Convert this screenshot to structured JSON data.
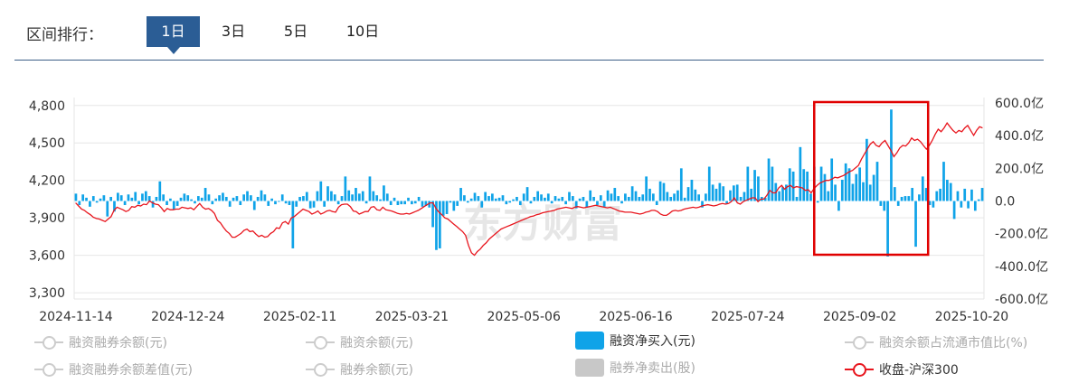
{
  "tabs": {
    "label": "区间排行：",
    "items": [
      "1日",
      "3日",
      "5日",
      "10日"
    ],
    "active": "1日"
  },
  "colors": {
    "bars": "#0fa3e8",
    "line": "#e8151d",
    "highlight": "#e00000",
    "watermark": "#e6e6e6"
  },
  "watermark": "东方财富",
  "legend": [
    {
      "label": "融资融券余额(元)",
      "symbol": "line",
      "active": false
    },
    {
      "label": "融资余额(元)",
      "symbol": "line",
      "active": false
    },
    {
      "label": "融资净买入(元)",
      "symbol": "bar",
      "color": "#0fa3e8",
      "active": true
    },
    {
      "label": "融资余额占流通市值比(%)",
      "symbol": "line",
      "active": false
    },
    {
      "label": "融资融券余额差值(元)",
      "symbol": "line",
      "active": false
    },
    {
      "label": "融券余额(元)",
      "symbol": "line",
      "active": false
    },
    {
      "label": "融券净卖出(股)",
      "symbol": "bar",
      "color": "#c8c8c8",
      "active": false
    },
    {
      "label": "收盘-沪深300",
      "symbol": "line-red",
      "active": true
    }
  ],
  "chart_data": {
    "type": "bar+line",
    "x_tick_labels": [
      "2024-11-14",
      "2024-12-24",
      "2025-02-11",
      "2025-03-21",
      "2025-05-06",
      "2025-06-16",
      "2025-07-24",
      "2025-09-02",
      "2025-10-20"
    ],
    "left_axis": {
      "ticks": [
        "4,800",
        "4,500",
        "4,200",
        "3,900",
        "3,600",
        "3,300"
      ],
      "ylim": [
        3250,
        4820
      ]
    },
    "right_axis": {
      "ticks": [
        "600.0亿",
        "400.0亿",
        "200.0亿",
        "0.0",
        "-200.0亿",
        "-400.0亿",
        "-600.0亿"
      ],
      "ylim": [
        -600,
        600
      ]
    },
    "grid": true,
    "highlight_box": {
      "from_index": 212,
      "to_index": 242
    },
    "series": [
      {
        "name": "融资净买入(元)",
        "axis": "right",
        "type": "bar",
        "values": [
          45,
          -25,
          40,
          20,
          -35,
          30,
          -10,
          15,
          35,
          -95,
          25,
          -65,
          50,
          35,
          -25,
          40,
          20,
          55,
          -20,
          45,
          60,
          30,
          -40,
          25,
          120,
          40,
          -25,
          15,
          -55,
          -30,
          20,
          45,
          35,
          10,
          -15,
          30,
          20,
          80,
          40,
          -20,
          15,
          35,
          50,
          25,
          -35,
          20,
          30,
          -25,
          40,
          60,
          35,
          -55,
          25,
          65,
          40,
          -30,
          15,
          -20,
          -5,
          40,
          -15,
          -25,
          -290,
          -35,
          25,
          30,
          55,
          -45,
          -40,
          60,
          120,
          -35,
          90,
          60,
          40,
          -20,
          30,
          150,
          65,
          40,
          80,
          45,
          60,
          -15,
          150,
          60,
          35,
          10,
          95,
          45,
          -25,
          20,
          -25,
          -20,
          -20,
          20,
          -20,
          -15,
          25,
          -35,
          -30,
          -40,
          -160,
          -300,
          -290,
          -90,
          -80,
          -10,
          -60,
          -30,
          80,
          35,
          -10,
          15,
          50,
          30,
          -40,
          55,
          30,
          45,
          15,
          20,
          35,
          -20,
          -10,
          10,
          25,
          -25,
          45,
          85,
          -15,
          25,
          60,
          40,
          20,
          45,
          -15,
          30,
          15,
          25,
          -20,
          55,
          30,
          -45,
          15,
          25,
          -40,
          65,
          25,
          -25,
          35,
          -35,
          65,
          45,
          80,
          30,
          -15,
          45,
          25,
          90,
          60,
          25,
          40,
          150,
          75,
          45,
          -25,
          120,
          110,
          55,
          25,
          45,
          65,
          200,
          20,
          85,
          130,
          70,
          40,
          -40,
          45,
          210,
          100,
          75,
          110,
          90,
          -15,
          65,
          95,
          100,
          25,
          55,
          210,
          75,
          190,
          150,
          25,
          20,
          260,
          210,
          110,
          60,
          85,
          100,
          200,
          180,
          25,
          330,
          195,
          180,
          45,
          210,
          -10,
          210,
          165,
          60,
          260,
          100,
          -60,
          130,
          230,
          200,
          105,
          165,
          205,
          115,
          380,
          100,
          160,
          240,
          -30,
          -60,
          -340,
          560,
          85,
          -30,
          25,
          30,
          30,
          80,
          -280,
          40,
          150,
          80,
          -25,
          -40,
          60,
          75,
          240,
          130,
          110,
          -110,
          60,
          -40,
          75,
          -45,
          70,
          -60,
          10,
          80
        ]
      },
      {
        "name": "收盘-沪深300",
        "axis": "left",
        "type": "line",
        "values": [
          4020,
          3995,
          3970,
          3960,
          3940,
          3925,
          3905,
          3895,
          3890,
          3880,
          3870,
          3890,
          3910,
          3960,
          3985,
          3975,
          3965,
          3950,
          3960,
          3990,
          3985,
          4000,
          3995,
          4010,
          4005,
          4035,
          4020,
          4010,
          4005,
          3980,
          3950,
          3975,
          3965,
          3965,
          3970,
          3970,
          3985,
          3980,
          3975,
          3980,
          3965,
          3990,
          4015,
          3985,
          3970,
          3975,
          3960,
          3935,
          3880,
          3860,
          3825,
          3795,
          3775,
          3745,
          3745,
          3760,
          3775,
          3800,
          3810,
          3790,
          3795,
          3770,
          3750,
          3760,
          3745,
          3750,
          3775,
          3790,
          3820,
          3815,
          3860,
          3870,
          3850,
          3900,
          3910,
          3930,
          3950,
          3970,
          3960,
          3950,
          3930,
          3940,
          3955,
          3930,
          3940,
          3955,
          3960,
          3950,
          3945,
          3985,
          4005,
          4010,
          4010,
          3990,
          3955,
          3950,
          3930,
          3940,
          3950,
          3950,
          3985,
          3990,
          3965,
          3960,
          3985,
          3965,
          3960,
          3955,
          3945,
          3935,
          3930,
          3930,
          3935,
          3930,
          3940,
          3950,
          3960,
          3975,
          3990,
          4005,
          4020,
          4020,
          3975,
          3945,
          3925,
          3900,
          3890,
          3870,
          3850,
          3830,
          3810,
          3790,
          3760,
          3680,
          3620,
          3600,
          3630,
          3650,
          3680,
          3700,
          3730,
          3750,
          3770,
          3790,
          3810,
          3820,
          3830,
          3840,
          3850,
          3860,
          3870,
          3880,
          3890,
          3900,
          3910,
          3915,
          3925,
          3930,
          3940,
          3945,
          3950,
          3955,
          3960,
          3970,
          3975,
          3980,
          3985,
          3980,
          3975,
          3985,
          3990,
          3985,
          3980,
          3985,
          3990,
          3995,
          4000,
          3995,
          3990,
          3985,
          3980,
          3985,
          3975,
          3965,
          3955,
          3950,
          3945,
          3945,
          3945,
          3940,
          3935,
          3930,
          3935,
          3945,
          3950,
          3960,
          3960,
          3950,
          3930,
          3920,
          3920,
          3935,
          3955,
          3960,
          3955,
          3960,
          3970,
          3975,
          3980,
          3985,
          3980,
          3985,
          3995,
          4000,
          4005,
          4000,
          3995,
          4000,
          4010,
          4015,
          4010,
          4015,
          4030,
          4060,
          4020,
          4010,
          4030,
          4040,
          4050,
          4060,
          4060,
          4030,
          4050,
          4050,
          4080,
          4120,
          4100,
          4100,
          4140,
          4160,
          4130,
          4150,
          4160,
          4140,
          4150,
          4145,
          4140,
          4120,
          4125,
          4100,
          4135,
          4160,
          4180,
          4190,
          4200,
          4200,
          4210,
          4225,
          4220,
          4230,
          4240,
          4255,
          4270,
          4280,
          4300,
          4320,
          4370,
          4410,
          4450,
          4490,
          4510,
          4480,
          4470,
          4500,
          4520,
          4480,
          4440,
          4390,
          4420,
          4460,
          4480,
          4475,
          4500,
          4540,
          4520,
          4530,
          4510,
          4480,
          4450,
          4480,
          4520,
          4570,
          4610,
          4590,
          4620,
          4660,
          4630,
          4600,
          4580,
          4600,
          4590,
          4620,
          4640,
          4600,
          4560,
          4600,
          4630,
          4620
        ]
      }
    ]
  }
}
